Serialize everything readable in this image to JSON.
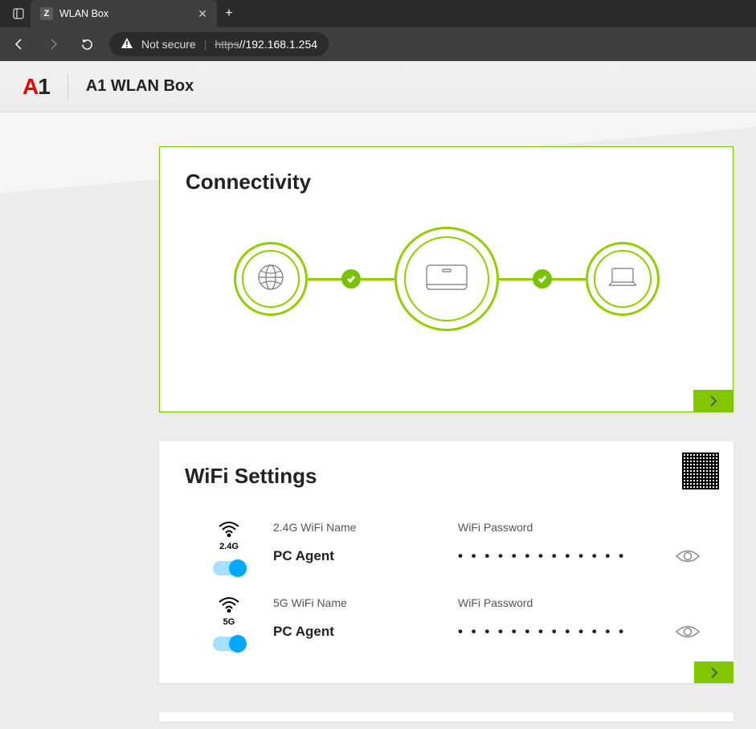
{
  "browser": {
    "tab_title": "WLAN Box",
    "favicon_letter": "Z",
    "not_secure": "Not secure",
    "url_protocol": "https",
    "url_rest": "//192.168.1.254"
  },
  "header": {
    "title": "A1 WLAN Box"
  },
  "connectivity": {
    "title": "Connectivity"
  },
  "wifi": {
    "title": "WiFi Settings",
    "bands": [
      {
        "band": "2.4G",
        "name_label": "2.4G WiFi Name",
        "name_value": "PC Agent",
        "password_label": "WiFi Password",
        "password_masked": "• • • • • • • • • • • • •"
      },
      {
        "band": "5G",
        "name_label": "5G WiFi Name",
        "name_value": "PC Agent",
        "password_label": "WiFi Password",
        "password_masked": "• • • • • • • • • • • • •"
      }
    ]
  }
}
